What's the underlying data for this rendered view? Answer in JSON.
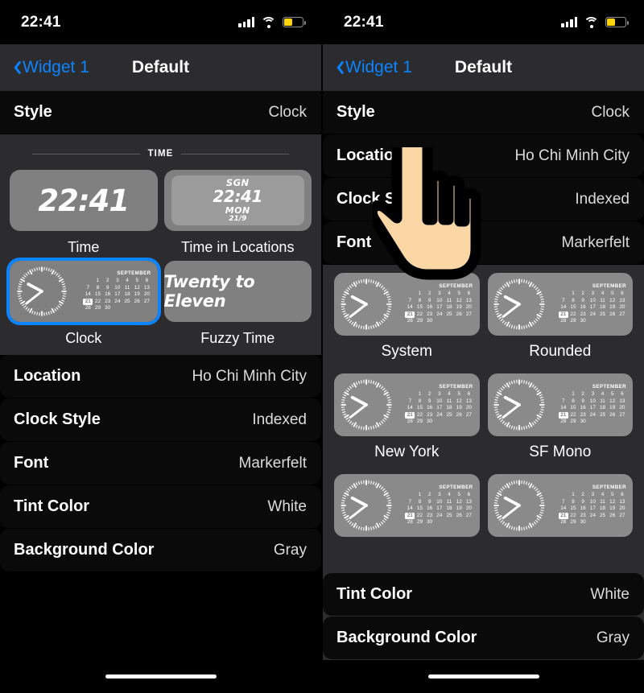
{
  "theme": {
    "accent": "#0a84ff",
    "row_bg": "#0a0a0a",
    "group_bg": "#2c2c2e",
    "tile_gray": "#808080",
    "battery_yellow": "#ffd60a",
    "screen_bg": "#000000"
  },
  "status_bar": {
    "time": "22:41",
    "cellular_icon": "signal-bars-icon",
    "wifi_icon": "wifi-icon",
    "battery_icon": "battery-icon",
    "battery_level_percent": 45
  },
  "nav": {
    "back_icon": "chevron-left-icon",
    "back_label": "Widget 1",
    "title": "Default"
  },
  "left_panel": {
    "rows_top": [
      {
        "key": "Style",
        "value": "Clock"
      }
    ],
    "section": {
      "header": "TIME",
      "tiles": [
        {
          "label": "Time",
          "type": "big-time",
          "time": "22:41",
          "selected": false
        },
        {
          "label": "Time in Locations",
          "type": "locations",
          "city": "SGN",
          "time": "22:41",
          "day": "MON",
          "date": "21/9",
          "selected": false
        },
        {
          "label": "Clock",
          "type": "clock-calendar",
          "selected": true
        },
        {
          "label": "Fuzzy Time",
          "type": "fuzzy",
          "text": "Twenty to Eleven",
          "selected": false
        }
      ]
    },
    "rows_bottom": [
      {
        "key": "Location",
        "value": "Ho Chi Minh City"
      },
      {
        "key": "Clock Style",
        "value": "Indexed"
      },
      {
        "key": "Font",
        "value": "Markerfelt"
      },
      {
        "key": "Tint Color",
        "value": "White"
      },
      {
        "key": "Background Color",
        "value": "Gray"
      }
    ]
  },
  "right_panel": {
    "rows_top": [
      {
        "key": "Style",
        "value": "Clock"
      },
      {
        "key": "Location",
        "value": "Ho Chi Minh City"
      },
      {
        "key": "Clock Style",
        "value": "Indexed"
      },
      {
        "key": "Font",
        "value": "Markerfelt"
      }
    ],
    "font_tiles": [
      {
        "label": "System"
      },
      {
        "label": "Rounded"
      },
      {
        "label": "New York"
      },
      {
        "label": "SF Mono"
      },
      {
        "label": ""
      },
      {
        "label": ""
      }
    ],
    "rows_bottom": [
      {
        "key": "Tint Color",
        "value": "White"
      },
      {
        "key": "Background Color",
        "value": "Gray"
      }
    ],
    "cursor": "pointing-hand-cursor"
  },
  "calendar": {
    "month": "SEPTEMBER",
    "weeks": [
      [
        "",
        "1",
        "2",
        "3",
        "4",
        "5",
        "6"
      ],
      [
        "7",
        "8",
        "9",
        "10",
        "11",
        "12",
        "13"
      ],
      [
        "14",
        "15",
        "16",
        "17",
        "18",
        "19",
        "20"
      ],
      [
        "21",
        "22",
        "23",
        "24",
        "25",
        "26",
        "27"
      ],
      [
        "28",
        "29",
        "30",
        "",
        "",
        "",
        ""
      ]
    ],
    "highlight_day": "21"
  },
  "clock_face": {
    "hour_angle_deg": -62,
    "minute_angle_deg": 232
  }
}
